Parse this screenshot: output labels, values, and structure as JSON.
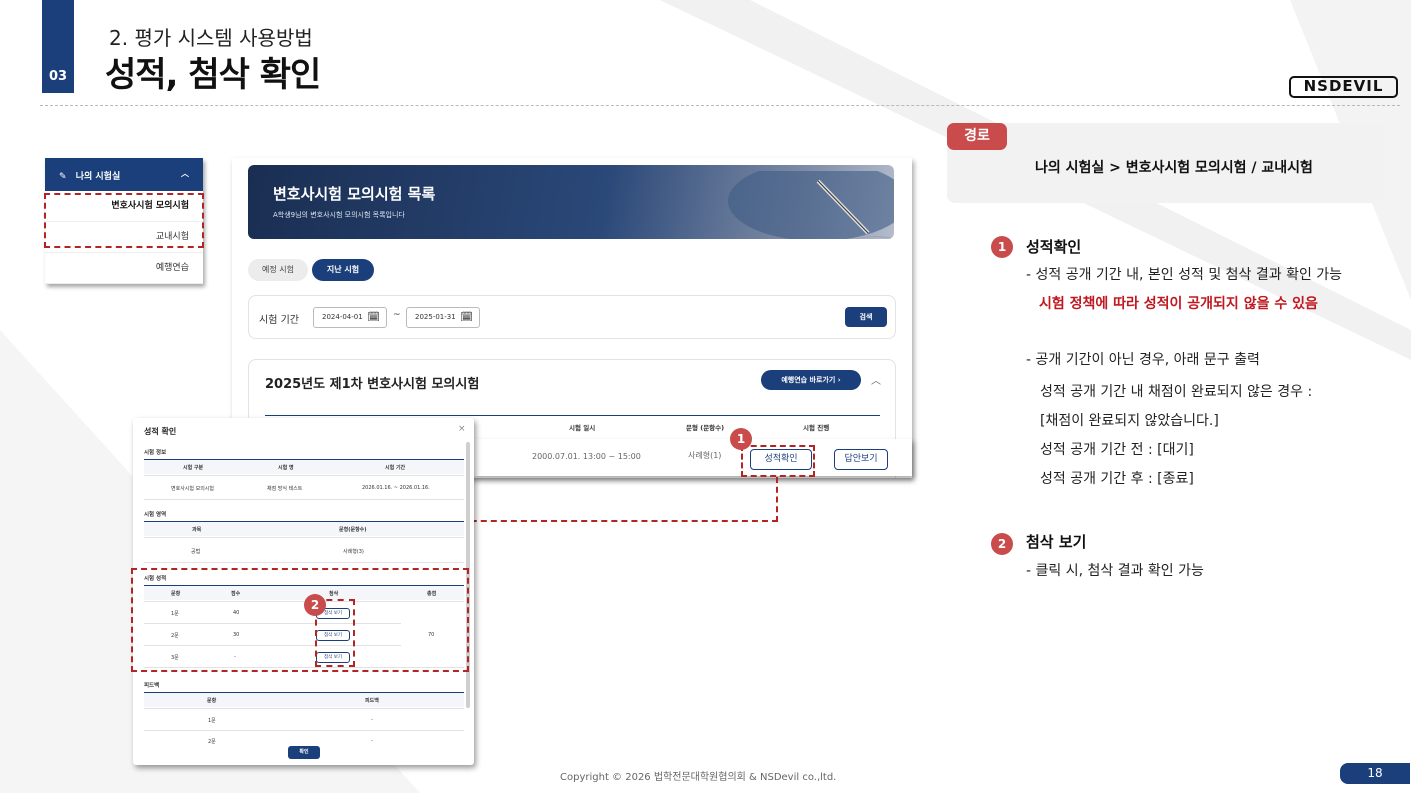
{
  "header": {
    "section_number": "03",
    "subtitle": "2. 평가 시스템 사용방법",
    "title": "성적, 첨삭 확인",
    "logo_text": "NSDEVIL"
  },
  "sidebar": {
    "title": "나의 시험실",
    "items": [
      "변호사시험 모의시험",
      "교내시험",
      "예행연습"
    ]
  },
  "exam_page": {
    "banner_title": "변호사시험 모의시험 목록",
    "banner_subtitle": "A학생9님의 변호사시험 모의시험 목록입니다",
    "tabs": [
      "예정 시험",
      "지난 시험"
    ],
    "filter": {
      "label": "시험 기간",
      "date_from": "2024-04-01",
      "tilde": "~",
      "date_to": "2025-01-31",
      "search_button": "검색"
    },
    "exam": {
      "title": "2025년도 제1차 변호사시험 모의시험",
      "practice_button": "예행연습 바로가기",
      "columns": [
        "시험 일시",
        "문형 (문항수)",
        "시험 진행"
      ],
      "row": {
        "date": "2000.07.01. 13:00 ~ 15:00",
        "type": "사례형(1)",
        "score_button": "성적확인",
        "answer_button": "답안보기"
      }
    }
  },
  "modal": {
    "title": "성적 확인",
    "close": "×",
    "sections": [
      "시험 정보",
      "시험 영역",
      "시험 성적",
      "피드백"
    ],
    "info": {
      "headers": [
        "시험 구분",
        "시험 명",
        "시험 기간"
      ],
      "values": [
        "변호사시험 모의시험",
        "채점 방식 테스트",
        "2026.01.16. ~ 2026.01.16."
      ]
    },
    "area": {
      "headers": [
        "과목",
        "문형(문항수)"
      ],
      "values": [
        "공법",
        "사례형(3)"
      ]
    },
    "score": {
      "headers": [
        "문항",
        "점수",
        "첨삭",
        "총점"
      ],
      "rows": [
        {
          "q": "1문",
          "score": "40",
          "button": "첨삭 보기"
        },
        {
          "q": "2문",
          "score": "30",
          "button": "첨삭 보기"
        },
        {
          "q": "3문",
          "score": "-",
          "button": "첨삭 보기"
        }
      ],
      "total": "70"
    },
    "feedback": {
      "headers": [
        "문항",
        "피드백"
      ],
      "rows": [
        {
          "q": "1문",
          "v": "-"
        },
        {
          "q": "2문",
          "v": "-"
        }
      ]
    },
    "ok_button": "확인"
  },
  "badges": [
    "1",
    "2"
  ],
  "right": {
    "route_tag": "경로",
    "route_text": "나의 시험실 > 변호사시험 모의시험 / 교내시험",
    "item1_title": "성적확인",
    "item1_line1": "- 성적 공개 기간 내, 본인 성적 및 첨삭 결과 확인 가능",
    "item1_red": "시험 정책에 따라 성적이 공개되지 않을 수 있음",
    "item1_line2": "- 공개 기간이 아닌 경우, 아래 문구 출력",
    "item1_line3": "성적 공개 기간 내 채점이 완료되지 않은 경우 :",
    "item1_line4": "[채점이 완료되지 않았습니다.]",
    "item1_line5": "성적 공개 기간 전 : [대기]",
    "item1_line6": "성적 공개 기간 후 : [종료]",
    "item2_title": "첨삭 보기",
    "item2_line1": "- 클릭 시, 첨삭 결과 확인 가능"
  },
  "footer": {
    "copyright": "Copyright © 2026 법학전문대학원협의회 & NSDevil co.,ltd.",
    "page": "18"
  },
  "colors": {
    "navy": "#1b3f7a",
    "accent_red": "#c94b4b",
    "highlight_red": "#c0181f"
  },
  "icons": [
    "edit-icon",
    "chevron-up-icon",
    "calendar-icon",
    "chevron-right-icon",
    "close-icon"
  ]
}
